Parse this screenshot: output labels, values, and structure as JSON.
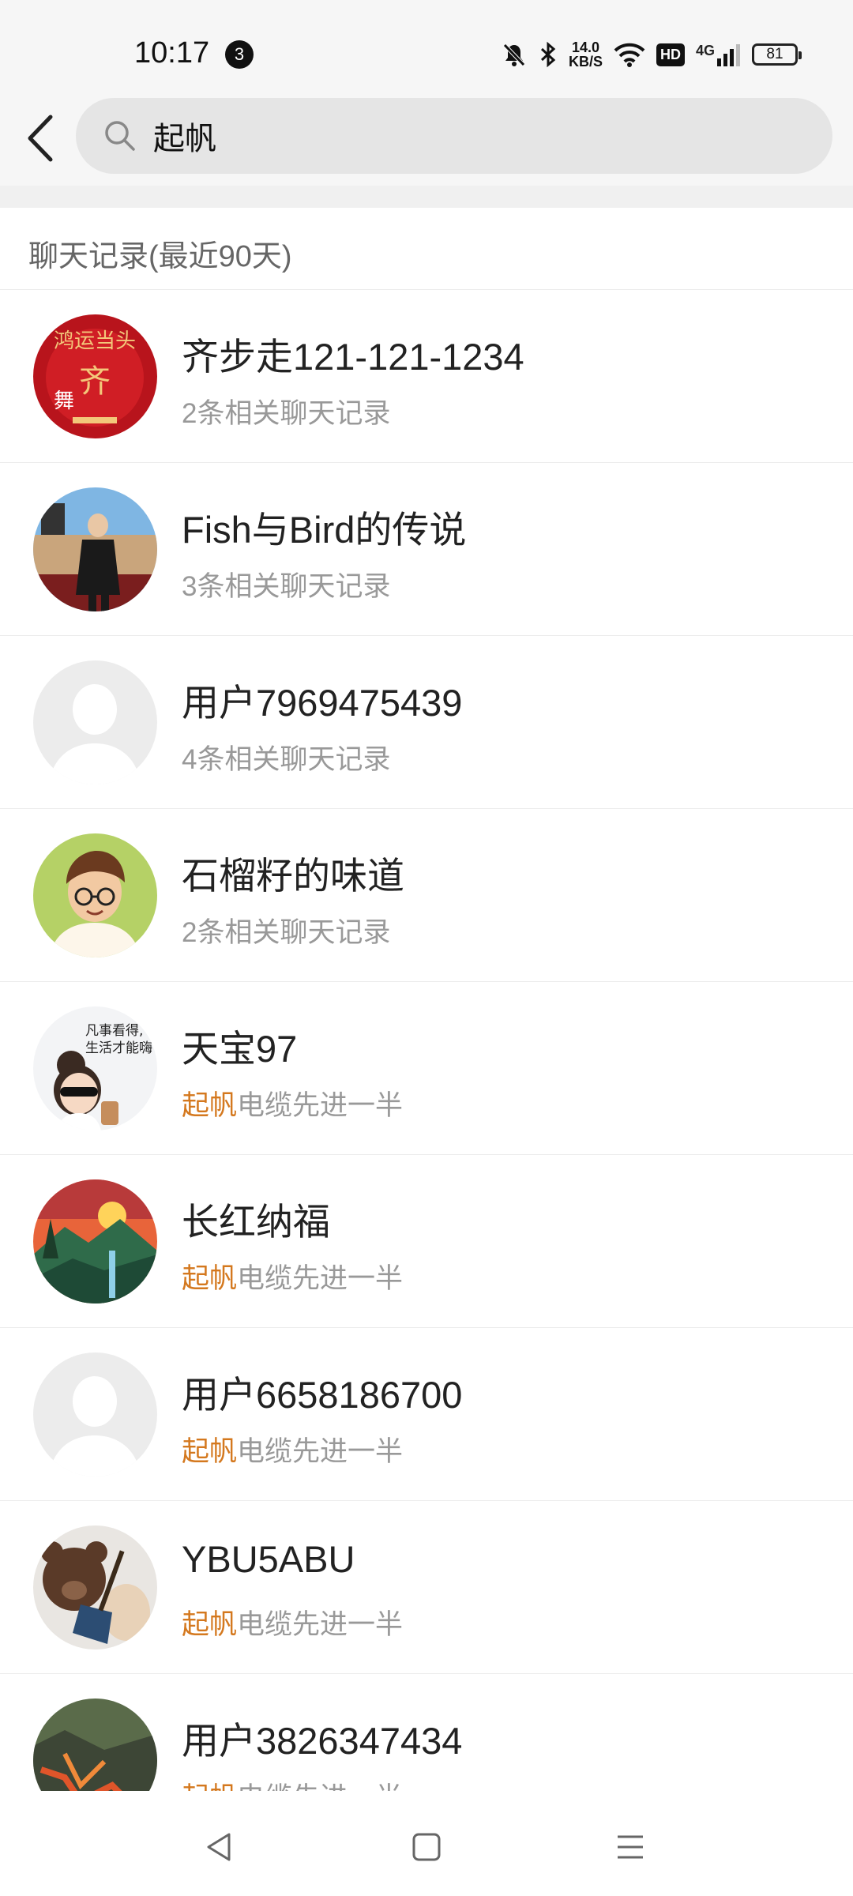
{
  "status_bar": {
    "time": "10:17",
    "notification_count": "3",
    "net_speed_value": "14.0",
    "net_speed_unit": "KB/S",
    "hd_label": "HD",
    "network_type": "4G",
    "battery": "81",
    "icons": [
      "mute-bell-icon",
      "bluetooth-icon",
      "wifi-icon",
      "signal-icon",
      "battery-icon"
    ]
  },
  "header": {
    "back_icon": "back-arrow-icon",
    "search_icon": "search-icon",
    "search_value": "起帆"
  },
  "section": {
    "title": "聊天记录(最近90天)"
  },
  "highlight_color": "#d4781e",
  "results": [
    {
      "name": "齐步走121-121-1234",
      "count_text": "2条相关聊天记录",
      "avatar": "red-calligraphy-avatar"
    },
    {
      "name": "Fish与Bird的传说",
      "count_text": "3条相关聊天记录",
      "avatar": "person-photo-avatar"
    },
    {
      "name": "用户7969475439",
      "count_text": "4条相关聊天记录",
      "avatar": "default-avatar"
    },
    {
      "name": "石榴籽的味道",
      "count_text": "2条相关聊天记录",
      "avatar": "cartoon-boy-avatar"
    },
    {
      "name": "天宝97",
      "match_highlight": "起帆",
      "match_rest": "电缆先进一半",
      "avatar": "cartoon-girl-avatar"
    },
    {
      "name": "长红纳福",
      "match_highlight": "起帆",
      "match_rest": "电缆先进一半",
      "avatar": "sunset-landscape-avatar"
    },
    {
      "name": "用户6658186700",
      "match_highlight": "起帆",
      "match_rest": "电缆先进一半",
      "avatar": "default-avatar"
    },
    {
      "name": "YBU5ABU",
      "match_highlight": "起帆",
      "match_rest": "电缆先进一半",
      "avatar": "teddy-bear-avatar"
    },
    {
      "name": "用户3826347434",
      "match_highlight": "起帆",
      "match_rest": "电缆先进一半",
      "avatar": "lava-landscape-avatar"
    }
  ],
  "nav_bar": {
    "icons": [
      "nav-back-icon",
      "nav-home-icon",
      "nav-menu-icon"
    ]
  }
}
